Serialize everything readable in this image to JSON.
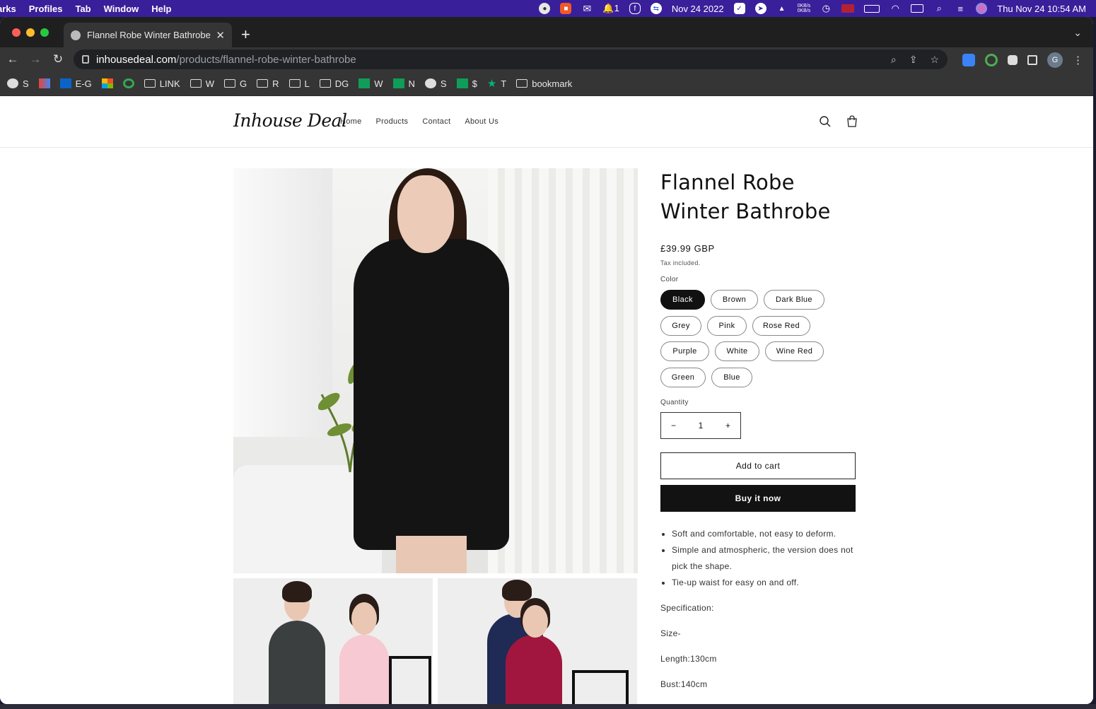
{
  "menubar": {
    "items": [
      "arks",
      "Profiles",
      "Tab",
      "Window",
      "Help"
    ],
    "date_short": "Nov 24 2022",
    "notif_count": "1",
    "net_up": "0KB/s",
    "net_down": "0KB/s",
    "datetime": "Thu Nov 24  10:54 AM"
  },
  "browser": {
    "tab_title": "Flannel Robe Winter Bathrobe -",
    "url_host": "inhousedeal.com",
    "url_path": "/products/flannel-robe-winter-bathrobe",
    "avatar_letter": "G",
    "bookmarks": [
      "S",
      "",
      "E-G",
      "",
      "",
      "LINK",
      "W",
      "G",
      "R",
      "L",
      "DG",
      "W",
      "N",
      "S",
      "$",
      "T",
      "bookmark"
    ]
  },
  "site": {
    "logo": "Inhouse Deal",
    "nav": [
      "Home",
      "Products",
      "Contact",
      "About Us"
    ]
  },
  "product": {
    "title": "Flannel Robe Winter Bathrobe",
    "price": "£39.99 GBP",
    "tax_note": "Tax included.",
    "color_label": "Color",
    "colors": [
      "Black",
      "Brown",
      "Dark Blue",
      "Grey",
      "Pink",
      "Rose Red",
      "Purple",
      "White",
      "Wine Red",
      "Green",
      "Blue"
    ],
    "selected_color": "Black",
    "quantity_label": "Quantity",
    "quantity": "1",
    "minus": "−",
    "plus": "+",
    "add_to_cart": "Add to cart",
    "buy_now": "Buy it now",
    "bullets": [
      "Soft and comfortable, not easy to deform.",
      "Simple and atmospheric, the version does not pick the shape.",
      "Tie-up waist for easy on and off."
    ],
    "spec_heading": "Specification:",
    "size": "Size-",
    "length": "Length:130cm",
    "bust": "Bust:140cm"
  },
  "colors": {
    "menubar_bg": "#3a1f9a",
    "chrome_dark": "#353535",
    "accent_black": "#121212"
  }
}
